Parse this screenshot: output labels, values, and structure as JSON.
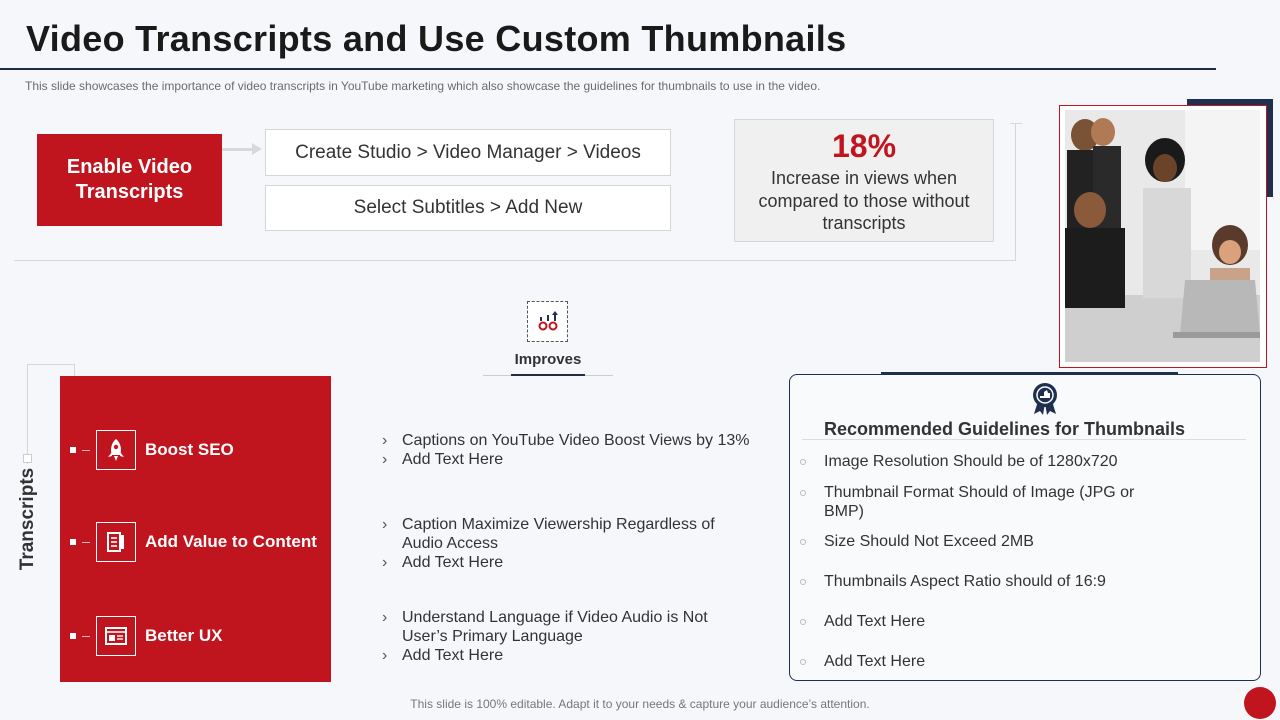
{
  "header": {
    "title": "Video Transcripts and Use Custom Thumbnails",
    "subtitle": "This slide showcases the importance of video transcripts in YouTube  marketing which also showcase the guidelines for thumbnails to use in the video."
  },
  "enable": {
    "label": "Enable Video Transcripts",
    "steps": [
      "Create Studio > Video Manager > Videos",
      "Select Subtitles > Add New"
    ]
  },
  "stat": {
    "percent": "18%",
    "text": "Increase in views when compared to those without transcripts"
  },
  "improves": {
    "label": "Improves",
    "icon": "growth-chart-icon"
  },
  "transcripts": {
    "label": "Transcripts",
    "benefits": [
      {
        "label": "Boost SEO",
        "icon": "rocket-icon"
      },
      {
        "label": "Add Value to Content",
        "icon": "document-icon"
      },
      {
        "label": "Better UX",
        "icon": "ux-window-icon"
      }
    ]
  },
  "details": [
    [
      "Captions on YouTube  Video Boost Views by 13%",
      "Add Text Here"
    ],
    [
      "Caption Maximize Viewership Regardless  of Audio Access",
      "Add Text Here"
    ],
    [
      "Understand Language if Video Audio is Not User’s Primary Language",
      "Add Text Here"
    ]
  ],
  "guidelines": {
    "title": "Recommended Guidelines for Thumbnails",
    "icon": "award-badge-icon",
    "items": [
      "Image Resolution Should be of 1280x720",
      "Thumbnail  Format Should of Image (JPG or BMP)",
      "Size Should Not Exceed 2MB",
      "Thumbnails Aspect Ratio should of 16:9",
      "Add Text Here",
      "Add Text Here"
    ]
  },
  "footer": "This slide is 100% editable. Adapt it to your needs & capture your audience’s attention.",
  "colors": {
    "accent_red": "#c0141e",
    "navy": "#1f2f4f",
    "background": "#f5f7fa"
  }
}
